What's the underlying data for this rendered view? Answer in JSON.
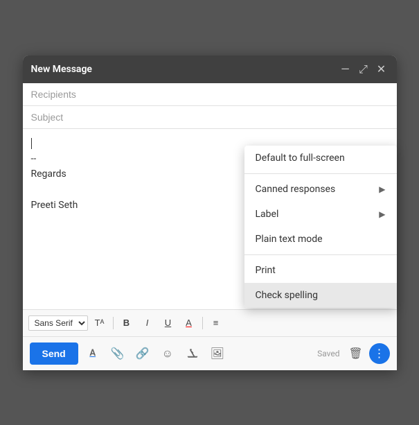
{
  "header": {
    "title": "New Message",
    "minimize_label": "—",
    "expand_label": "⤢",
    "close_label": "✕"
  },
  "fields": {
    "recipients_placeholder": "Recipients",
    "subject_placeholder": "Subject"
  },
  "body": {
    "cursor_present": true,
    "line1": "--",
    "line2": "Regards",
    "line3": "",
    "line4": "Preeti Seth"
  },
  "toolbar": {
    "font_name": "Sans Serif",
    "font_size_icon": "Tᴬ",
    "bold": "B",
    "italic": "I",
    "underline": "U",
    "font_color": "A",
    "align": "≡"
  },
  "footer": {
    "send_label": "Send",
    "saved_label": "Saved"
  },
  "dropdown": {
    "items": [
      {
        "label": "Default to full-screen",
        "has_arrow": false,
        "highlighted": false
      },
      {
        "label": "Canned responses",
        "has_arrow": true,
        "highlighted": false
      },
      {
        "label": "Label",
        "has_arrow": true,
        "highlighted": false
      },
      {
        "label": "Plain text mode",
        "has_arrow": false,
        "highlighted": false
      },
      {
        "label": "Print",
        "has_arrow": false,
        "highlighted": false
      },
      {
        "label": "Check spelling",
        "has_arrow": false,
        "highlighted": true
      }
    ]
  },
  "icons": {
    "formatting_icon": "Tᴬ",
    "attachment_icon": "📎",
    "link_icon": "🔗",
    "emoji_icon": "☺",
    "drive_icon": "△",
    "image_icon": "🖼",
    "trash_icon": "🗑",
    "more_vert": "⋮"
  }
}
